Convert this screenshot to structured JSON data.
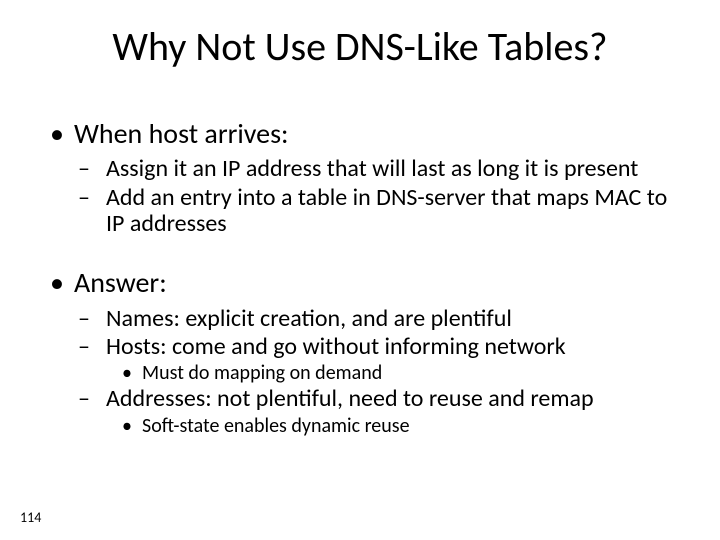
{
  "slide": {
    "title": "Why Not Use DNS-Like Tables?",
    "number": "114",
    "body": {
      "item1": {
        "label": "When host arrives:",
        "sub": [
          "Assign it an IP address that will last as long it is present",
          "Add an entry into a table in DNS-server that maps MAC to IP addresses"
        ]
      },
      "item2": {
        "label": "Answer:",
        "sub1": "Names: explicit creation, and are plentiful",
        "sub2": "Hosts: come and go without informing network",
        "sub2a": "Must do mapping on demand",
        "sub3": "Addresses: not plentiful, need to reuse and remap",
        "sub3a": "Soft-state enables dynamic reuse"
      }
    }
  }
}
